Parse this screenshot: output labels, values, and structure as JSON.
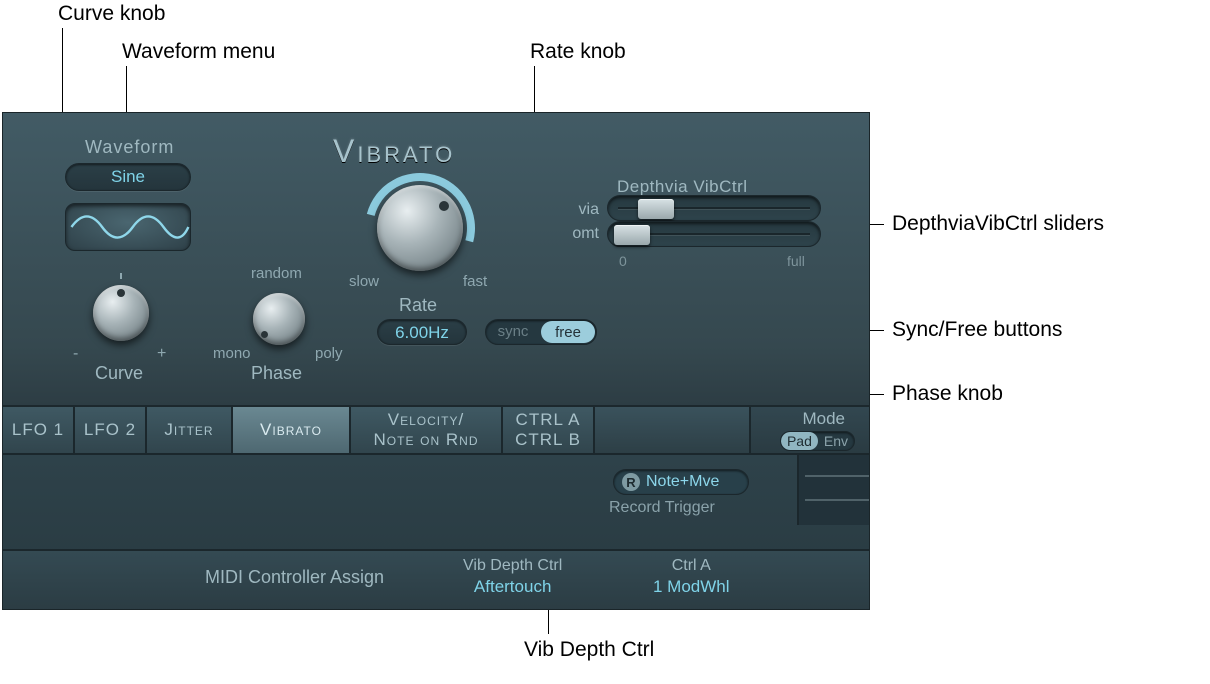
{
  "callouts": {
    "curve_knob": "Curve knob",
    "waveform_menu": "Waveform menu",
    "rate_knob": "Rate knob",
    "depth_sliders": "DepthviaVibCtrl sliders",
    "syncfree": "Sync/Free buttons",
    "phase_knob": "Phase knob",
    "vib_depth_ctrl": "Vib Depth Ctrl"
  },
  "vibrato": {
    "title": "Vibrato",
    "waveform_label": "Waveform",
    "waveform_value": "Sine",
    "curve": {
      "label": "Curve",
      "minus": "-",
      "plus": "+"
    },
    "phase": {
      "label": "Phase",
      "random": "random",
      "mono": "mono",
      "poly": "poly"
    },
    "rate": {
      "label": "Rate",
      "slow": "slow",
      "fast": "fast",
      "value": "6.00Hz"
    },
    "sync": {
      "sync": "sync",
      "free": "free",
      "selected": "free"
    },
    "depth": {
      "title": "Depthvia VibCtrl",
      "via": "via",
      "omt": "omt",
      "scale_min": "0",
      "scale_max": "full"
    }
  },
  "tabs": {
    "items": [
      "LFO 1",
      "LFO 2",
      "Jitter",
      "Vibrato",
      "Velocity/\nNote on Rnd",
      "CTRL A\nCTRL B"
    ],
    "active_index": 3,
    "mode": {
      "label": "Mode",
      "pad": "Pad",
      "env": "Env",
      "selected": "Pad"
    }
  },
  "lower": {
    "record_trigger_value": "Note+Mve",
    "record_trigger_label": "Record Trigger",
    "midi_label": "MIDI Controller Assign",
    "vib_depth": {
      "header": "Vib Depth Ctrl",
      "value": "Aftertouch"
    },
    "ctrl_a": {
      "header": "Ctrl A",
      "value": "1 ModWhl"
    }
  }
}
